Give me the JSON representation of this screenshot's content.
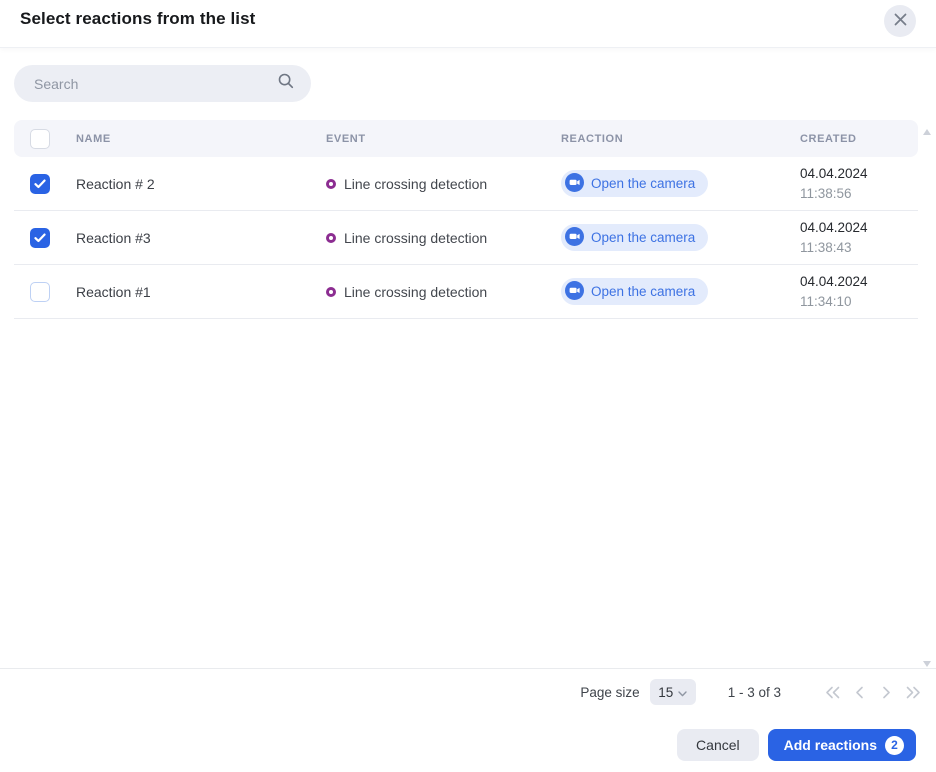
{
  "modal": {
    "title": "Select reactions from the list"
  },
  "search": {
    "placeholder": "Search"
  },
  "table": {
    "columns": {
      "name": "NAME",
      "event": "EVENT",
      "reaction": "REACTION",
      "created": "CREATED"
    },
    "header_checkbox_checked": false,
    "rows": [
      {
        "checked": true,
        "name": "Reaction # 2",
        "event": "Line crossing detection",
        "reaction": "Open the camera",
        "date": "04.04.2024",
        "time": "11:38:56"
      },
      {
        "checked": true,
        "name": "Reaction #3",
        "event": "Line crossing detection",
        "reaction": "Open the camera",
        "date": "04.04.2024",
        "time": "11:38:43"
      },
      {
        "checked": false,
        "name": "Reaction #1",
        "event": "Line crossing detection",
        "reaction": "Open the camera",
        "date": "04.04.2024",
        "time": "11:34:10"
      }
    ]
  },
  "pagination": {
    "page_size_label": "Page size",
    "page_size_value": "15",
    "range_text": "1 - 3 of 3"
  },
  "actions": {
    "cancel_label": "Cancel",
    "add_label": "Add reactions",
    "selected_count": "2"
  },
  "colors": {
    "accent_blue": "#2a63e4",
    "chip_bg": "#e3ebfc",
    "chip_text": "#3d72e3",
    "event_icon_purple": "#8c2d91",
    "header_bg": "#f4f5fa",
    "neutral_pill": "#e9ebf2"
  }
}
